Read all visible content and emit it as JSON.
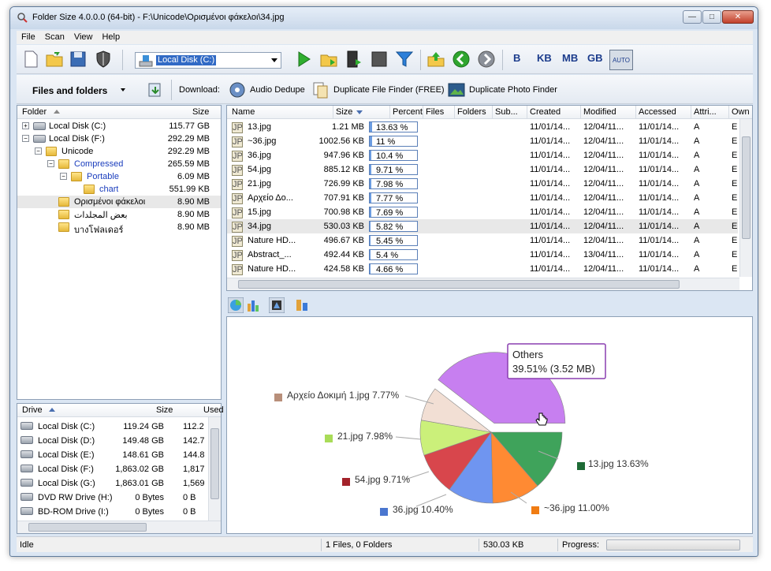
{
  "window": {
    "title": "Folder Size 4.0.0.0 (64-bit) - F:\\Unicode\\Ορισμένοι φάκελοι\\34.jpg"
  },
  "menu": [
    "File",
    "Scan",
    "View",
    "Help"
  ],
  "toolbar": {
    "drive": "Local Disk (C:)",
    "units": [
      "B",
      "KB",
      "MB",
      "GB"
    ],
    "auto": "AUTO"
  },
  "toolbar2": {
    "files_folders": "Files and folders",
    "download": "Download:",
    "audio": "Audio Dedupe",
    "dup_file": "Duplicate File Finder (FREE)",
    "dup_photo": "Duplicate Photo Finder"
  },
  "folder_panel": {
    "headers": {
      "folder": "Folder",
      "size": "Size"
    },
    "rows": [
      {
        "name": "Local Disk (C:)",
        "size": "115.77 GB",
        "level": 0,
        "type": "drive",
        "color": "#000"
      },
      {
        "name": "Local Disk (F:)",
        "size": "292.29 MB",
        "level": 0,
        "type": "drive",
        "color": "#000"
      },
      {
        "name": "Unicode",
        "size": "292.29 MB",
        "level": 1,
        "type": "folder",
        "color": "#000"
      },
      {
        "name": "Compressed",
        "size": "265.59 MB",
        "level": 2,
        "type": "folder",
        "color": "#1a3dbd"
      },
      {
        "name": "Portable",
        "size": "6.09 MB",
        "level": 3,
        "type": "folder",
        "color": "#1a3dbd"
      },
      {
        "name": "chart",
        "size": "551.99 KB",
        "level": 4,
        "type": "folder",
        "color": "#1a3dbd"
      },
      {
        "name": "Ορισμένοι φάκελοι",
        "size": "8.90 MB",
        "level": 2,
        "type": "folder",
        "color": "#000"
      },
      {
        "name": "بعض المجلدات",
        "size": "8.90 MB",
        "level": 2,
        "type": "folder",
        "color": "#000"
      },
      {
        "name": "บางโฟลเดอร์",
        "size": "8.90 MB",
        "level": 2,
        "type": "folder",
        "color": "#000"
      }
    ]
  },
  "drive_panel": {
    "headers": {
      "drive": "Drive",
      "size": "Size",
      "used": "Used"
    },
    "rows": [
      {
        "name": "Local Disk (C:)",
        "size": "119.24 GB",
        "used": "112.2"
      },
      {
        "name": "Local Disk (D:)",
        "size": "149.48 GB",
        "used": "142.7"
      },
      {
        "name": "Local Disk (E:)",
        "size": "148.61 GB",
        "used": "144.8"
      },
      {
        "name": "Local Disk (F:)",
        "size": "1,863.02 GB",
        "used": "1,817"
      },
      {
        "name": "Local Disk (G:)",
        "size": "1,863.01 GB",
        "used": "1,569"
      },
      {
        "name": "DVD RW Drive (H:)",
        "size": "0 Bytes",
        "used": "0 B"
      },
      {
        "name": "BD-ROM Drive (I:)",
        "size": "0 Bytes",
        "used": "0 B"
      }
    ]
  },
  "file_panel": {
    "headers": [
      "Name",
      "Size",
      "Percent",
      "Files",
      "Folders",
      "Sub...",
      "Created",
      "Modified",
      "Accessed",
      "Attri...",
      "Own"
    ],
    "rows": [
      {
        "name": "13.jpg",
        "size": "1.21 MB",
        "pct": 13.63,
        "pct_label": "13.63 %",
        "created": "11/01/14...",
        "modified": "12/04/11...",
        "accessed": "11/01/14...",
        "attr": "A",
        "own": "E"
      },
      {
        "name": "~36.jpg",
        "size": "1002.56 KB",
        "pct": 11,
        "pct_label": "11 %",
        "created": "11/01/14...",
        "modified": "12/04/11...",
        "accessed": "11/01/14...",
        "attr": "A",
        "own": "E"
      },
      {
        "name": "36.jpg",
        "size": "947.96 KB",
        "pct": 10.4,
        "pct_label": "10.4 %",
        "created": "11/01/14...",
        "modified": "12/04/11...",
        "accessed": "11/01/14...",
        "attr": "A",
        "own": "E"
      },
      {
        "name": "54.jpg",
        "size": "885.12 KB",
        "pct": 9.71,
        "pct_label": "9.71 %",
        "created": "11/01/14...",
        "modified": "12/04/11...",
        "accessed": "11/01/14...",
        "attr": "A",
        "own": "E"
      },
      {
        "name": "21.jpg",
        "size": "726.99 KB",
        "pct": 7.98,
        "pct_label": "7.98 %",
        "created": "11/01/14...",
        "modified": "12/04/11...",
        "accessed": "11/01/14...",
        "attr": "A",
        "own": "E"
      },
      {
        "name": "Αρχείο Δο...",
        "size": "707.91 KB",
        "pct": 7.77,
        "pct_label": "7.77 %",
        "created": "11/01/14...",
        "modified": "12/04/11...",
        "accessed": "11/01/14...",
        "attr": "A",
        "own": "E"
      },
      {
        "name": "15.jpg",
        "size": "700.98 KB",
        "pct": 7.69,
        "pct_label": "7.69 %",
        "created": "11/01/14...",
        "modified": "12/04/11...",
        "accessed": "11/01/14...",
        "attr": "A",
        "own": "E"
      },
      {
        "name": "34.jpg",
        "size": "530.03 KB",
        "pct": 5.82,
        "pct_label": "5.82 %",
        "created": "11/01/14...",
        "modified": "12/04/11...",
        "accessed": "11/01/14...",
        "attr": "A",
        "own": "E"
      },
      {
        "name": "Nature HD...",
        "size": "496.67 KB",
        "pct": 5.45,
        "pct_label": "5.45 %",
        "created": "11/01/14...",
        "modified": "12/04/11...",
        "accessed": "11/01/14...",
        "attr": "A",
        "own": "E"
      },
      {
        "name": "Abstract_...",
        "size": "492.44 KB",
        "pct": 5.4,
        "pct_label": "5.4 %",
        "created": "11/01/14...",
        "modified": "13/04/11...",
        "accessed": "11/01/14...",
        "attr": "A",
        "own": "E"
      },
      {
        "name": "Nature HD...",
        "size": "424.58 KB",
        "pct": 4.66,
        "pct_label": "4.66 %",
        "created": "11/01/14...",
        "modified": "12/04/11...",
        "accessed": "11/01/14...",
        "attr": "A",
        "own": "E"
      }
    ]
  },
  "chart_data": {
    "type": "pie",
    "title": "",
    "slices": [
      {
        "label": "13.jpg 13.63%",
        "value": 13.63,
        "color": "#3fa35b"
      },
      {
        "label": "~36.jpg 11.00%",
        "value": 11.0,
        "color": "#ff8a33"
      },
      {
        "label": "36.jpg 10.40%",
        "value": 10.4,
        "color": "#6f95f0"
      },
      {
        "label": "54.jpg 9.71%",
        "value": 9.71,
        "color": "#d8464c"
      },
      {
        "label": "21.jpg 7.98%",
        "value": 7.98,
        "color": "#cbf07a"
      },
      {
        "label": "Αρχείο Δοκιμή 1.jpg 7.77%",
        "value": 7.77,
        "color": "#f2dfd4"
      },
      {
        "label": "Others 39.51%",
        "value": 39.51,
        "color": "#c77ff0"
      }
    ],
    "legend_colors": {
      "13.jpg 13.63%": "#1e6b36",
      "~36.jpg 11.00%": "#f07c13",
      "36.jpg 10.40%": "#4a76cf",
      "54.jpg 9.71%": "#a3222a",
      "21.jpg 7.98%": "#a9dc58",
      "Αρχείο Δοκιμή 1.jpg 7.77%": "#b88f7a",
      "Others 39.51%": "#c9a3e6"
    },
    "tooltip": {
      "line1": "Others",
      "line2": "39.51% (3.52 MB)"
    }
  },
  "status": {
    "state": "Idle",
    "count": "1 Files, 0 Folders",
    "size": "530.03 KB",
    "progress": "Progress:"
  }
}
